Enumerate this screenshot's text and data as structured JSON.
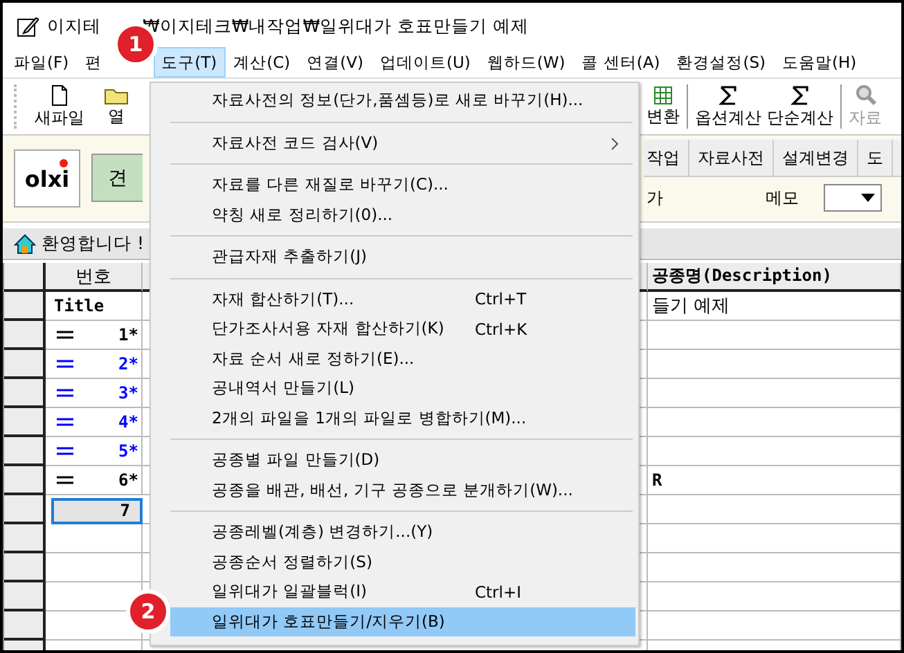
{
  "window": {
    "title_parts": [
      "이지테",
      "₩이지테크₩내작업₩일위대가 호표만들기 예제"
    ]
  },
  "menu_bar": [
    {
      "label": "파일(F)",
      "selected": false
    },
    {
      "label": "편",
      "selected": false
    },
    {
      "label": "도구(T)",
      "selected": true
    },
    {
      "label": "계산(C)",
      "selected": false
    },
    {
      "label": "연결(V)",
      "selected": false
    },
    {
      "label": "업데이트(U)",
      "selected": false
    },
    {
      "label": "웹하드(W)",
      "selected": false
    },
    {
      "label": "콜 센터(A)",
      "selected": false
    },
    {
      "label": "환경설정(S)",
      "selected": false
    },
    {
      "label": "도움말(H)",
      "selected": false
    }
  ],
  "toolbar_left": [
    {
      "label": "새파일",
      "kind": "file",
      "disabled": false
    },
    {
      "label": "열",
      "kind": "folder",
      "disabled": false
    }
  ],
  "toolbar_right": [
    {
      "label": "변환",
      "kind": "sheet",
      "disabled": false
    },
    {
      "label": "옵션계산",
      "kind": "sigma",
      "disabled": false
    },
    {
      "label": "단순계산",
      "kind": "sigma",
      "disabled": false
    },
    {
      "label": "자료",
      "kind": "search",
      "disabled": true
    }
  ],
  "panel": {
    "logo": "olxi",
    "green_button": "견",
    "tabs": [
      {
        "label": "작업",
        "selected": false
      },
      {
        "label": "자료사전",
        "selected": false
      },
      {
        "label": "설계변경",
        "selected": false
      },
      {
        "label": "도",
        "selected": false
      }
    ],
    "field_label": "가",
    "memo_label": "메모"
  },
  "welcome": "환영합니다 !",
  "grid": {
    "columns": [
      "번호",
      "공종명(Description)"
    ],
    "rows": [
      {
        "number": "Title",
        "marker": false,
        "color": "#000000",
        "description": "들기 예제",
        "selected": false
      },
      {
        "number": "1*",
        "marker": true,
        "color": "#000000",
        "description": "",
        "selected": false
      },
      {
        "number": "2*",
        "marker": true,
        "color": "#0000ff",
        "description": "",
        "selected": false
      },
      {
        "number": "3*",
        "marker": true,
        "color": "#0000ff",
        "description": "",
        "selected": false
      },
      {
        "number": "4*",
        "marker": true,
        "color": "#0000ff",
        "description": "",
        "selected": false
      },
      {
        "number": "5*",
        "marker": true,
        "color": "#0000ff",
        "description": "",
        "selected": false
      },
      {
        "number": "6*",
        "marker": true,
        "color": "#000000",
        "description": "R",
        "selected": false
      },
      {
        "number": "7",
        "marker": false,
        "color": "#000000",
        "description": "",
        "selected": true
      }
    ]
  },
  "dropdown": [
    {
      "kind": "item",
      "label": "자료사전의 정보(단가,품셈등)로 새로 바꾸기(H)...",
      "selected": false
    },
    {
      "kind": "separator"
    },
    {
      "kind": "submenu",
      "label": "자료사전 코드 검사(V)",
      "selected": false
    },
    {
      "kind": "separator"
    },
    {
      "kind": "item",
      "label": "자료를 다른 재질로 바꾸기(C)...",
      "selected": false
    },
    {
      "kind": "item",
      "label": "약칭 새로 정리하기(0)...",
      "selected": false
    },
    {
      "kind": "separator"
    },
    {
      "kind": "item",
      "label": "관급자재 추출하기(J)",
      "selected": false
    },
    {
      "kind": "separator"
    },
    {
      "kind": "item",
      "label": "자재 합산하기(T)...",
      "shortcut": "Ctrl+T",
      "selected": false
    },
    {
      "kind": "item",
      "label": "단가조사서용 자재 합산하기(K)",
      "shortcut": "Ctrl+K",
      "selected": false
    },
    {
      "kind": "item",
      "label": "자료 순서 새로 정하기(E)...",
      "selected": false
    },
    {
      "kind": "item",
      "label": "공내역서 만들기(L)",
      "selected": false
    },
    {
      "kind": "item",
      "label": "2개의 파일을 1개의 파일로 병합하기(M)...",
      "selected": false
    },
    {
      "kind": "separator"
    },
    {
      "kind": "item",
      "label": "공종별 파일 만들기(D)",
      "selected": false
    },
    {
      "kind": "item",
      "label": "공종을 배관, 배선, 기구 공종으로 분개하기(W)...",
      "selected": false
    },
    {
      "kind": "separator"
    },
    {
      "kind": "item",
      "label": "공종레벨(계층) 변경하기...(Y)",
      "selected": false
    },
    {
      "kind": "item",
      "label": "공종순서 정렬하기(S)",
      "selected": false
    },
    {
      "kind": "item",
      "label": "일위대가 일괄블럭(I)",
      "shortcut": "Ctrl+I",
      "selected": false
    },
    {
      "kind": "item",
      "label": "일위대가 호표만들기/지우기(B)",
      "selected": true
    }
  ],
  "callouts": [
    "1",
    "2"
  ]
}
